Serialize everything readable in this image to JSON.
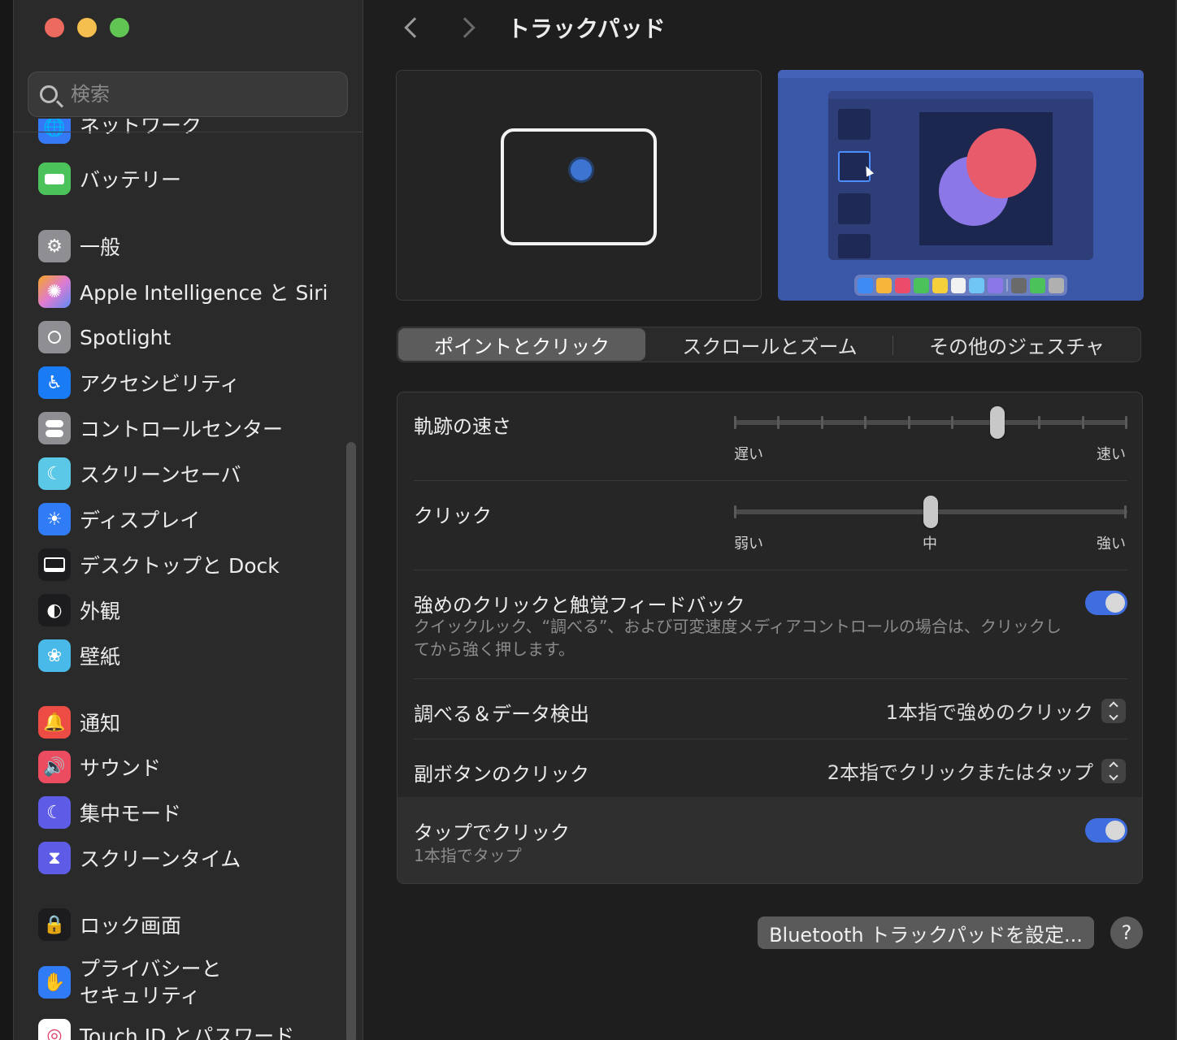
{
  "window": {
    "title": "トラックパッド"
  },
  "search": {
    "placeholder": "検索"
  },
  "sidebar": {
    "items": [
      {
        "label": "ネットワーク",
        "icon": "globe-icon",
        "color": "#3478f6"
      },
      {
        "label": "バッテリー",
        "icon": "battery-icon",
        "color": "#4cc35a"
      },
      {
        "label": "一般",
        "icon": "gear-icon",
        "color": "#8e8e93"
      },
      {
        "label": "Apple Intelligence と Siri",
        "icon": "siri-icon",
        "color": "#e07bd0"
      },
      {
        "label": "Spotlight",
        "icon": "magnifier-icon",
        "color": "#8e8e93"
      },
      {
        "label": "アクセシビリティ",
        "icon": "accessibility-icon",
        "color": "#1a7cf5"
      },
      {
        "label": "コントロールセンター",
        "icon": "switches-icon",
        "color": "#8e8e93"
      },
      {
        "label": "スクリーンセーバ",
        "icon": "screensaver-icon",
        "color": "#5ac8e6"
      },
      {
        "label": "ディスプレイ",
        "icon": "sun-icon",
        "color": "#2f7cf6"
      },
      {
        "label": "デスクトップと Dock",
        "icon": "dock-icon",
        "color": "#1c1c1e"
      },
      {
        "label": "外観",
        "icon": "appearance-icon",
        "color": "#1c1c1e"
      },
      {
        "label": "壁紙",
        "icon": "flower-icon",
        "color": "#48b9e8"
      },
      {
        "label": "通知",
        "icon": "bell-icon",
        "color": "#ec4c43"
      },
      {
        "label": "サウンド",
        "icon": "speaker-icon",
        "color": "#ec4c60"
      },
      {
        "label": "集中モード",
        "icon": "moon-icon",
        "color": "#5e5ce6"
      },
      {
        "label": "スクリーンタイム",
        "icon": "hourglass-icon",
        "color": "#5e5ce6"
      },
      {
        "label": "ロック画面",
        "icon": "lock-icon",
        "color": "#1c1c1e"
      },
      {
        "label": "プライバシーと\nセキュリティ",
        "icon": "hand-icon",
        "color": "#2f7cf6"
      },
      {
        "label": "Touch ID とパスワード",
        "icon": "fingerprint-icon",
        "color": "#ffffff"
      }
    ]
  },
  "tabs": [
    {
      "label": "ポイントとクリック",
      "active": true
    },
    {
      "label": "スクロールとズーム",
      "active": false
    },
    {
      "label": "その他のジェスチャ",
      "active": false
    }
  ],
  "settings": {
    "tracking": {
      "label": "軌跡の速さ",
      "min_label": "遅い",
      "max_label": "速い",
      "value": 0.67,
      "ticks": 10
    },
    "click": {
      "label": "クリック",
      "left_label": "弱い",
      "mid_label": "中",
      "right_label": "強い",
      "value": 0.5
    },
    "force_click": {
      "label": "強めのクリックと触覚フィードバック",
      "description": "クイックルック、“調べる”、および可変速度メディアコントロールの場合は、クリックしてから強く押します。",
      "enabled": true
    },
    "lookup": {
      "label": "調べる＆データ検出",
      "value": "1本指で強めのクリック"
    },
    "secondary_click": {
      "label": "副ボタンのクリック",
      "value": "2本指でクリックまたはタップ"
    },
    "tap_to_click": {
      "label": "タップでクリック",
      "description": "1本指でタップ",
      "enabled": true
    }
  },
  "footer": {
    "bluetooth_button": "Bluetooth トラックパッドを設定...",
    "help_label": "?"
  },
  "colors": {
    "accent": "#3e6ee0",
    "finger": "#3d74d1"
  }
}
